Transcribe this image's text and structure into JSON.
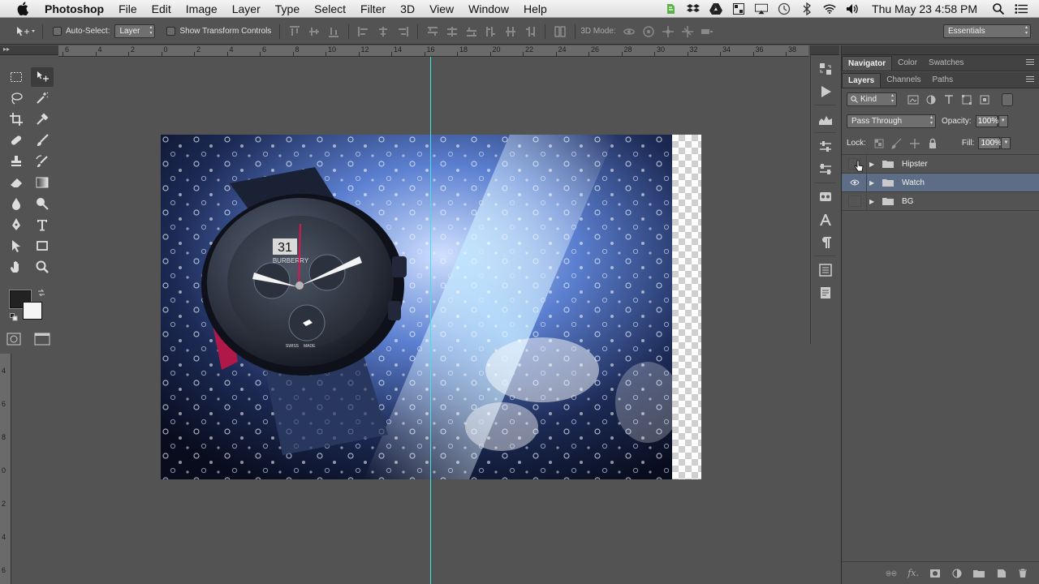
{
  "menubar": {
    "app": "Photoshop",
    "items": [
      "File",
      "Edit",
      "Image",
      "Layer",
      "Type",
      "Select",
      "Filter",
      "3D",
      "View",
      "Window",
      "Help"
    ],
    "clock": "Thu May 23  4:58 PM"
  },
  "options": {
    "auto_select_label": "Auto-Select:",
    "auto_select_value": "Layer",
    "transform_label": "Show Transform Controls",
    "mode_3d_label": "3D Mode:",
    "workspace": "Essentials"
  },
  "ruler": {
    "top_numbers": [
      "6",
      "4",
      "2",
      "0",
      "2",
      "4",
      "6",
      "8",
      "10",
      "12",
      "14",
      "16",
      "18",
      "20",
      "22",
      "24",
      "26",
      "28",
      "30",
      "32",
      "34",
      "36",
      "38"
    ],
    "left_numbers": [
      "4",
      "6",
      "8",
      "0",
      "2",
      "4",
      "6"
    ]
  },
  "panels": {
    "top_tabs": [
      "Navigator",
      "Color",
      "Swatches"
    ],
    "layer_tabs": [
      "Layers",
      "Channels",
      "Paths"
    ],
    "filter_kind": "Kind",
    "blend_mode": "Pass Through",
    "opacity_label": "Opacity:",
    "opacity_value": "100%",
    "lock_label": "Lock:",
    "fill_label": "Fill:",
    "fill_value": "100%",
    "layers": [
      {
        "name": "Hipster",
        "visible": false,
        "selected": false
      },
      {
        "name": "Watch",
        "visible": true,
        "selected": true
      },
      {
        "name": "BG",
        "visible": false,
        "selected": false
      }
    ]
  },
  "document": {
    "guide_color": "#3fe3e3",
    "watch_brand": "BURBERRY",
    "date_window": "31",
    "dial_text_left": "SWISS",
    "dial_text_right": "MADE"
  },
  "colors": {
    "foreground": "#222222",
    "background": "#f4f4f4",
    "selection": "#5c6d85"
  }
}
